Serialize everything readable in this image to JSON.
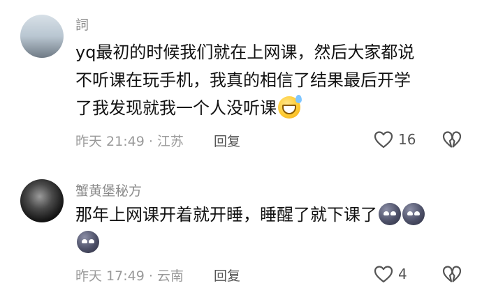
{
  "comments": [
    {
      "username": "詞",
      "lines": [
        "yq最初的时候我们就在上网课，然后大家都说",
        "不听课在玩手机，我真的相信了结果最后开学",
        "了我发现就我一个人没听课"
      ],
      "emoji": "sweat-smile-icon",
      "time_location": "昨天 21:49 · 江苏",
      "reply_label": "回复",
      "likes": "16"
    },
    {
      "username": "蟹黄堡秘方",
      "lines": [
        "那年上网课开着就开睡，睡醒了就下课了"
      ],
      "emoji": "smug-face-icon",
      "time_location": "昨天 17:49 · 云南",
      "reply_label": "回复",
      "likes": "4"
    }
  ]
}
